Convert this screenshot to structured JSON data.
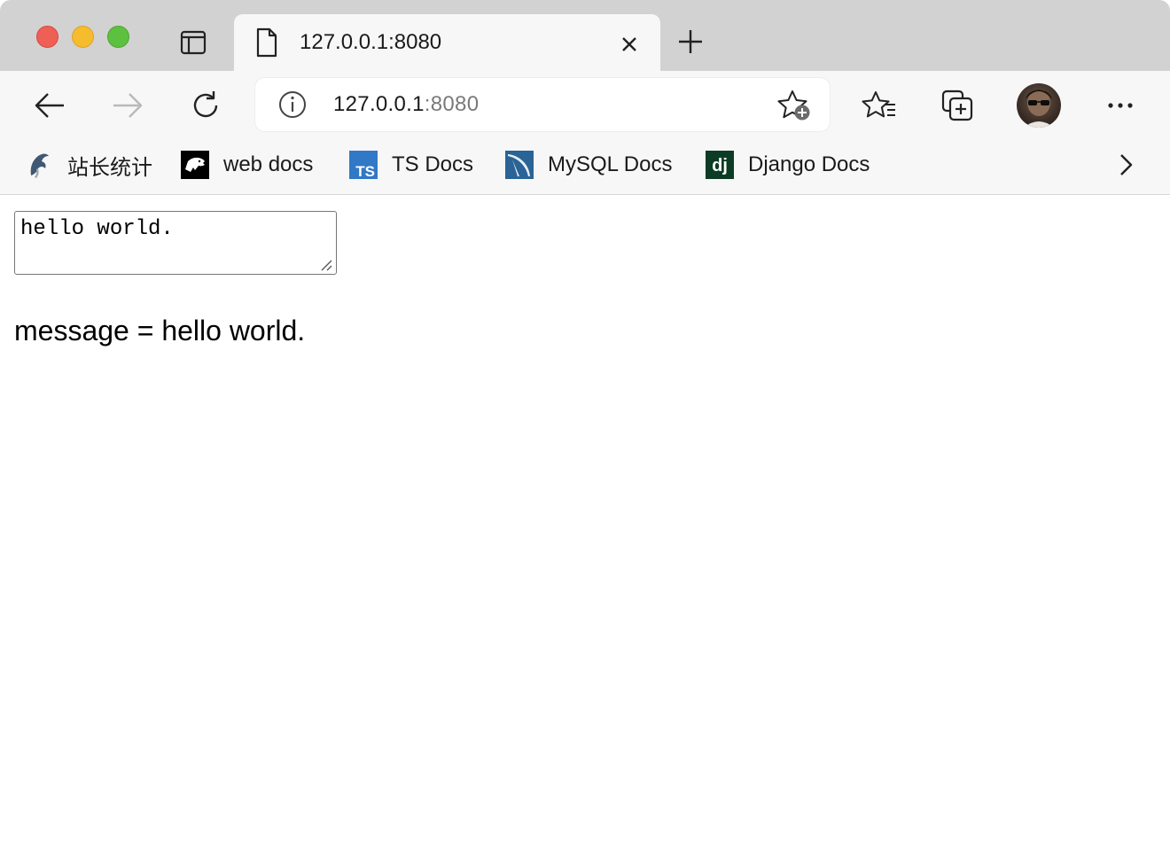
{
  "tab": {
    "title": "127.0.0.1:8080"
  },
  "address_bar": {
    "url_host": "127.0.0.1",
    "url_port": ":8080"
  },
  "bookmarks": [
    {
      "label": "站长统计",
      "icon": "cnzz-icon"
    },
    {
      "label": "web docs",
      "icon": "mdn-icon"
    },
    {
      "label": "TS Docs",
      "icon": "typescript-icon",
      "icon_text": "TS",
      "color": "#3178c6"
    },
    {
      "label": "MySQL Docs",
      "icon": "mysql-icon",
      "color": "#2a6396"
    },
    {
      "label": "Django Docs",
      "icon": "django-icon",
      "icon_text": "dj",
      "color": "#0c3c26"
    }
  ],
  "page": {
    "textarea_value": "hello world.",
    "message_label": "message = hello world."
  },
  "colors": {
    "tabstrip": "#d2d2d2",
    "toolbar": "#f7f7f7",
    "close": "#ee5f56",
    "minimize": "#f5bd2e",
    "zoom": "#5cc13e"
  }
}
